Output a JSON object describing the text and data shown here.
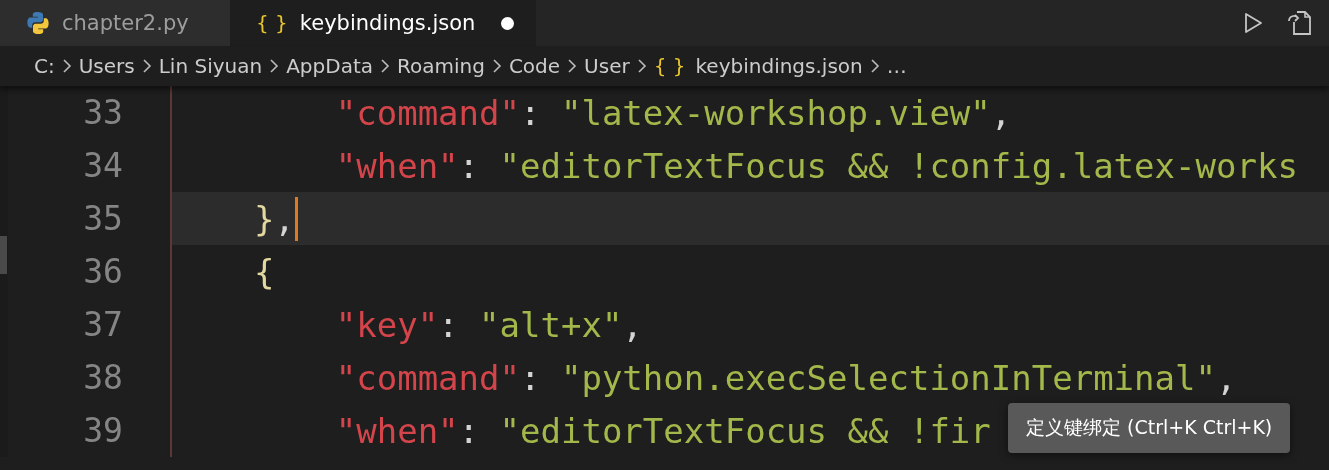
{
  "tabs": [
    {
      "label": "chapter2.py",
      "kind": "python",
      "selected": false,
      "modified": false
    },
    {
      "label": "keybindings.json",
      "kind": "json",
      "icon": "{ }",
      "selected": true,
      "modified": true
    }
  ],
  "breadcrumb": [
    {
      "label": "C:"
    },
    {
      "label": "Users"
    },
    {
      "label": "Lin Siyuan"
    },
    {
      "label": "AppData"
    },
    {
      "label": "Roaming"
    },
    {
      "label": "Code"
    },
    {
      "label": "User"
    },
    {
      "label": "keybindings.json",
      "icon": "{ }"
    },
    {
      "label": "…"
    }
  ],
  "lines": [
    {
      "number": "33",
      "kind": "member",
      "current": false,
      "tokens": [
        {
          "kind": "key",
          "text": "\"command\""
        },
        {
          "kind": "punct",
          "text": ": "
        },
        {
          "kind": "string",
          "text": "\"latex-workshop.view\""
        },
        {
          "kind": "punct",
          "text": ","
        }
      ]
    },
    {
      "number": "34",
      "kind": "member",
      "current": false,
      "tokens": [
        {
          "kind": "key",
          "text": "\"when\""
        },
        {
          "kind": "punct",
          "text": ": "
        },
        {
          "kind": "string",
          "text": "\"editorTextFocus && !config.latex-works"
        }
      ]
    },
    {
      "number": "35",
      "kind": "brace",
      "current": true,
      "tokens": [
        {
          "kind": "bracket",
          "text": "}"
        },
        {
          "kind": "punct",
          "text": ","
        }
      ]
    },
    {
      "number": "36",
      "kind": "brace",
      "current": false,
      "tokens": [
        {
          "kind": "bracket",
          "text": "{"
        }
      ]
    },
    {
      "number": "37",
      "kind": "member",
      "current": false,
      "tokens": [
        {
          "kind": "key",
          "text": "\"key\""
        },
        {
          "kind": "punct",
          "text": ": "
        },
        {
          "kind": "string",
          "text": "\"alt+x\""
        },
        {
          "kind": "punct",
          "text": ","
        }
      ]
    },
    {
      "number": "38",
      "kind": "member",
      "current": false,
      "tokens": [
        {
          "kind": "key",
          "text": "\"command\""
        },
        {
          "kind": "punct",
          "text": ": "
        },
        {
          "kind": "string",
          "text": "\"python.execSelectionInTerminal\""
        },
        {
          "kind": "punct",
          "text": ","
        }
      ]
    },
    {
      "number": "39",
      "kind": "member",
      "current": false,
      "tokens": [
        {
          "kind": "key",
          "text": "\"when\""
        },
        {
          "kind": "punct",
          "text": ": "
        },
        {
          "kind": "string",
          "text": "\"editorTextFocus && !fir"
        }
      ]
    }
  ],
  "tooltip": "定义键绑定 (Ctrl+K Ctrl+K)"
}
